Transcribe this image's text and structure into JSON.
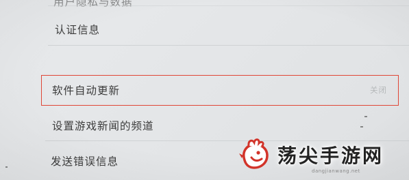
{
  "settings": {
    "partial_top_label": "用户隐私与数据",
    "items": [
      {
        "label": "认证信息"
      },
      {
        "label": "软件自动更新",
        "value": "关闭"
      },
      {
        "label": "设置游戏新闻的频道"
      },
      {
        "label": "发送错误信息"
      }
    ]
  },
  "watermark": {
    "brand": "荡尖手游网",
    "url": "dangjianwang.net"
  },
  "colors": {
    "highlight_border": "#e04535",
    "background": "#e4e6e8",
    "text": "#3c3c3c",
    "muted_value": "#b5b8ba"
  }
}
